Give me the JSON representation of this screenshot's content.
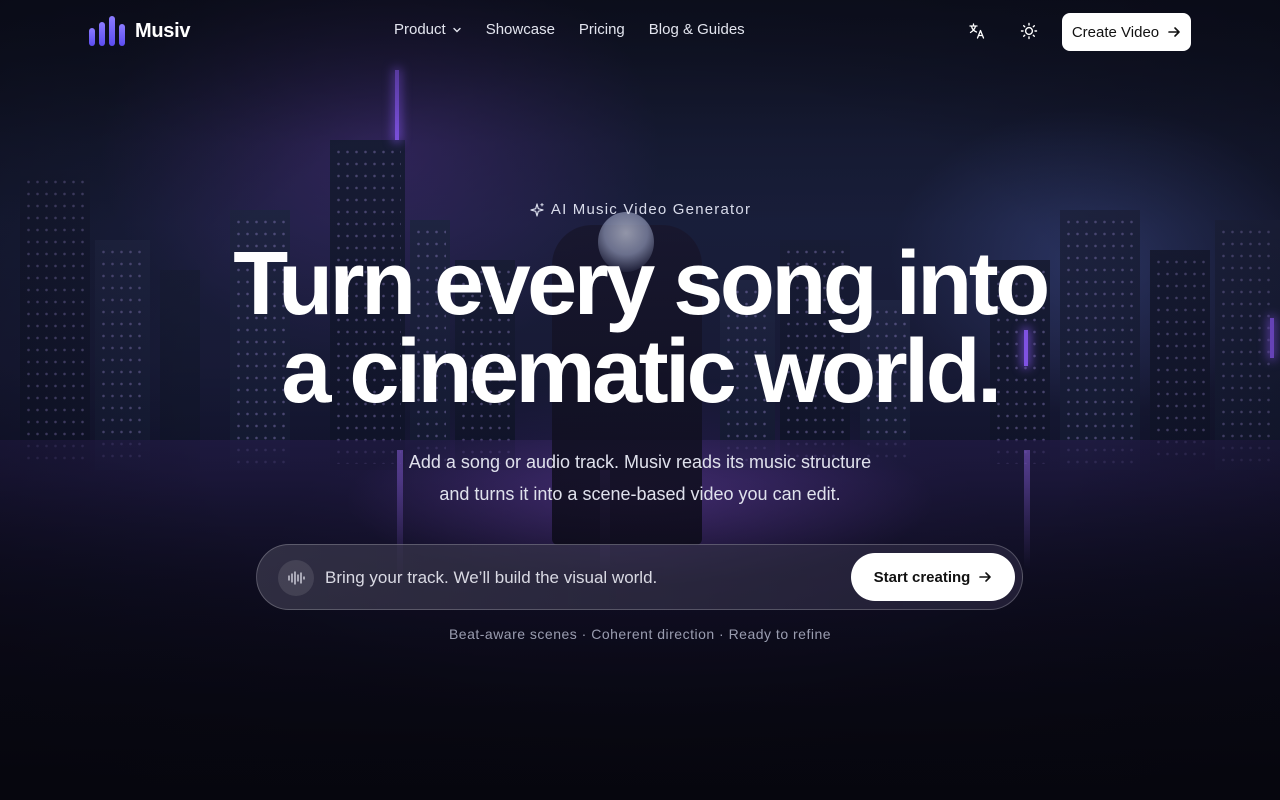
{
  "brand": {
    "name": "Musiv",
    "accent": "#6a5cf5"
  },
  "nav": {
    "links": [
      {
        "label": "Product",
        "has_dropdown": true
      },
      {
        "label": "Showcase"
      },
      {
        "label": "Pricing"
      },
      {
        "label": "Blog & Guides"
      }
    ],
    "language_icon": "translate-icon",
    "theme_icon": "sun-icon",
    "cta_label": "Create Video"
  },
  "hero": {
    "badge": "AI Music Video Generator",
    "headline_line1": "Turn every song into",
    "headline_line2": "a cinematic world.",
    "sub_line1": "Add a song or audio track. Musiv reads its music structure",
    "sub_line2": "and turns it into a scene-based video you can edit.",
    "prompt_placeholder": "Bring your track. We’ll build the visual world.",
    "start_label": "Start creating",
    "features": "Beat-aware scenes · Coherent direction · Ready to refine"
  }
}
